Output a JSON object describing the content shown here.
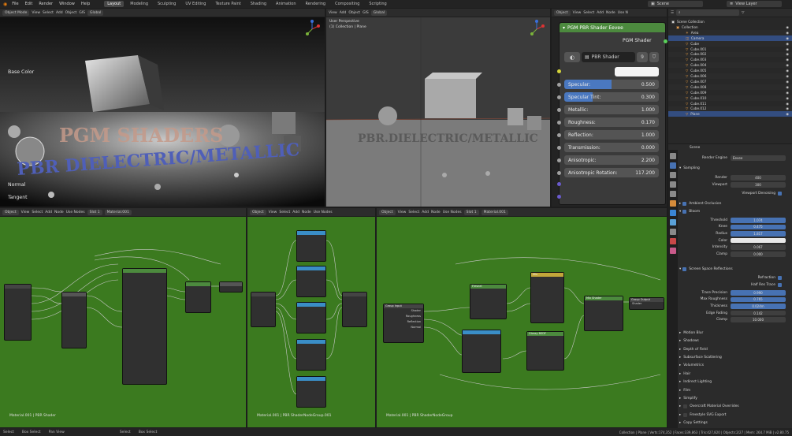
{
  "topbar": {
    "menus": [
      "File",
      "Edit",
      "Render",
      "Window",
      "Help"
    ],
    "workspaces": [
      "Layout",
      "Modeling",
      "Sculpting",
      "UV Editing",
      "Texture Paint",
      "Shading",
      "Animation",
      "Rendering",
      "Compositing",
      "Scripting"
    ],
    "active_workspace": "Layout",
    "scene": "Scene",
    "view_layer": "View Layer"
  },
  "viewport_left": {
    "header": [
      "Object Mode",
      "View",
      "Select",
      "Add",
      "Object",
      "GIS",
      "Global"
    ],
    "render_text_1": "PGM SHADERS",
    "render_text_2": "PBR DIELECTRIC/METALLIC"
  },
  "viewport_mid": {
    "header": [
      "View",
      "Add",
      "Object",
      "GIS",
      "Global"
    ],
    "perspective": "User Perspective",
    "collection": "(1) Collection | Plane",
    "scene_text": "PBR.DIELECTRIC/METALLIC"
  },
  "pbr_node": {
    "header_items": [
      "Object",
      "View",
      "Select",
      "Add",
      "Node",
      "Use N"
    ],
    "title": "PGM PBR Shader Eevee",
    "output": "PGM Shader",
    "group_name": "PBR Shader",
    "users": "9",
    "base_color_label": "Base Color",
    "params": [
      {
        "label": "Specular:",
        "value": "0.500",
        "fill": 0.5
      },
      {
        "label": "Specular Tint:",
        "value": "0.300",
        "fill": 0.3
      },
      {
        "label": "Metallic:",
        "value": "1.000",
        "fill": 0
      },
      {
        "label": "Roughness:",
        "value": "0.170",
        "fill": 0
      },
      {
        "label": "Reflection:",
        "value": "1.000",
        "fill": 0
      },
      {
        "label": "Transmission:",
        "value": "0.000",
        "fill": 0
      },
      {
        "label": "Anisotropic:",
        "value": "2.200",
        "fill": 0
      },
      {
        "label": "Anisotropic Rotation:",
        "value": "117.200",
        "fill": 0
      }
    ],
    "normal_label": "Normal",
    "tangent_label": "Tangent"
  },
  "outliner": {
    "root": "Scene Collection",
    "items": [
      {
        "name": "Collection",
        "sel": false
      },
      {
        "name": "Area",
        "sel": false
      },
      {
        "name": "Camera",
        "sel": true
      },
      {
        "name": "Cube",
        "sel": false
      },
      {
        "name": "Cube.001",
        "sel": false
      },
      {
        "name": "Cube.002",
        "sel": false
      },
      {
        "name": "Cube.003",
        "sel": false
      },
      {
        "name": "Cube.004",
        "sel": false
      },
      {
        "name": "Cube.005",
        "sel": false
      },
      {
        "name": "Cube.006",
        "sel": false
      },
      {
        "name": "Cube.007",
        "sel": false
      },
      {
        "name": "Cube.008",
        "sel": false
      },
      {
        "name": "Cube.009",
        "sel": false
      },
      {
        "name": "Cube.010",
        "sel": false
      },
      {
        "name": "Cube.011",
        "sel": false
      },
      {
        "name": "Cube.012",
        "sel": false
      },
      {
        "name": "Plane",
        "sel": true
      }
    ]
  },
  "properties": {
    "scene_name": "Scene",
    "render_engine_label": "Render Engine",
    "render_engine": "Eevee",
    "sampling": "Sampling",
    "render_label": "Render",
    "render_val": "400",
    "viewport_label": "Viewport",
    "viewport_val": "300",
    "viewport_denoising": "Viewport Denoising",
    "ao": "Ambient Occlusion",
    "bloom": "Bloom",
    "bloom_rows": [
      {
        "label": "Threshold",
        "value": "1.074"
      },
      {
        "label": "Knee",
        "value": "0.475"
      },
      {
        "label": "Radius",
        "value": "1.817"
      },
      {
        "label": "Color",
        "value": ""
      },
      {
        "label": "Intensity",
        "value": "0.067"
      },
      {
        "label": "Clamp",
        "value": "0.000"
      }
    ],
    "ssr": "Screen Space Reflections",
    "refraction": "Refraction",
    "half_res": "Half Res Trace",
    "ssr_rows": [
      {
        "label": "Trace Precision",
        "value": "0.990"
      },
      {
        "label": "Max Roughness",
        "value": "0.765"
      },
      {
        "label": "Thickness",
        "value": "0.024m"
      },
      {
        "label": "Edge Fading",
        "value": "0.142"
      },
      {
        "label": "Clamp",
        "value": "10.000"
      }
    ],
    "sections": [
      "Motion Blur",
      "Shadows",
      "Depth of Field",
      "Subsurface Scattering",
      "Volumetrics",
      "Hair",
      "Indirect Lighting",
      "Film",
      "Simplify",
      "Grease Pencil",
      "Freestyle SVG Export",
      "Copy Settings"
    ],
    "override_label": "Overcraft Material Overrides"
  },
  "node_editors": [
    {
      "header": [
        "Object",
        "View",
        "Select",
        "Add",
        "Node",
        "Use Nodes",
        "Slot 1",
        "Material.001"
      ],
      "footer": "Material.001 | PBR Shader"
    },
    {
      "header": [
        "Object",
        "View",
        "Select",
        "Add",
        "Node",
        "Use Nodes"
      ],
      "footer": "Material.001 | PBR ShaderNodeGroup.001"
    },
    {
      "header": [
        "Object",
        "View",
        "Select",
        "Add",
        "Node",
        "Use Nodes",
        "Slot 1",
        "Material.001"
      ],
      "footer": "Material.001 | PBR ShaderNodeGroup"
    }
  ],
  "ne3_nodes": {
    "group_input": "Group Input",
    "group_input_rows": [
      "Shader",
      "Roughness",
      "Reflection",
      "Normal"
    ],
    "fresnel": "Fresnel",
    "mix": "Mix",
    "mix_shader": "Mix Shader",
    "glossy": "Glossy BSDF",
    "group_output": "Group Output",
    "shader_out": "Shader"
  },
  "statusbar": {
    "left": [
      "Select",
      "Box Select",
      "Pan View",
      "Select",
      "Box Select"
    ],
    "right": "Collection | Plane | Verts:174,352 | Faces:339,863 | Tris:427,820 | Objects:2/27 | Mem: 264.7 MiB | v2.80.75"
  },
  "colors": {
    "node_bg": "#3b7a1f",
    "accent": "#4772b3",
    "pbr_header": "#4c8a3e"
  }
}
